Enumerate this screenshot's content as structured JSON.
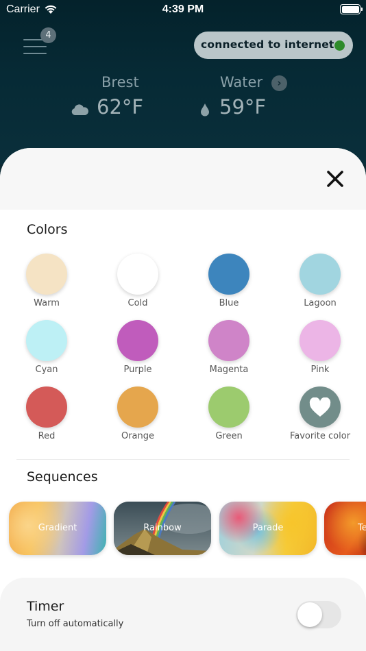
{
  "status_bar": {
    "carrier": "Carrier",
    "time": "4:39 PM"
  },
  "header": {
    "menu_badge": "4",
    "connection_status": "connected to internet",
    "connection_color": "#2e8b2b",
    "location": {
      "label": "Brest",
      "temperature": "62°F",
      "icon": "cloud-icon"
    },
    "water": {
      "label": "Water",
      "temperature": "59°F",
      "icon": "drop-icon"
    }
  },
  "colors": {
    "title": "Colors",
    "items": [
      {
        "label": "Warm",
        "color": "#f5e3c4"
      },
      {
        "label": "Cold",
        "color": "#ffffff"
      },
      {
        "label": "Blue",
        "color": "#3d85bd"
      },
      {
        "label": "Lagoon",
        "color": "#a1d5e0"
      },
      {
        "label": "Cyan",
        "color": "#bdf0f5"
      },
      {
        "label": "Purple",
        "color": "#c05cbc"
      },
      {
        "label": "Magenta",
        "color": "#cf84c8"
      },
      {
        "label": "Pink",
        "color": "#ecb5e6"
      },
      {
        "label": "Red",
        "color": "#d45a58"
      },
      {
        "label": "Orange",
        "color": "#e5a64d"
      },
      {
        "label": "Green",
        "color": "#9ccb6e"
      },
      {
        "label": "Favorite color",
        "color": "#728d8a",
        "icon": "heart-icon"
      }
    ]
  },
  "sequences": {
    "title": "Sequences",
    "items": [
      {
        "label": "Gradient"
      },
      {
        "label": "Rainbow"
      },
      {
        "label": "Parade"
      },
      {
        "label": "Te"
      }
    ]
  },
  "timer": {
    "title": "Timer",
    "subtitle": "Turn off automatically",
    "enabled": false
  }
}
